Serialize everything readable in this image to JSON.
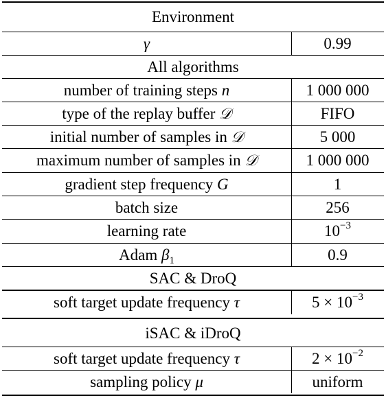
{
  "table": {
    "sections": [
      {
        "title": "Environment",
        "rows": [
          {
            "param": "",
            "symbol": "γ",
            "value": "0.99"
          }
        ]
      },
      {
        "title": "All algorithms",
        "rows": [
          {
            "param": "number of training steps",
            "symbol": "n",
            "value": "1 000 000"
          },
          {
            "param": "type of the replay buffer",
            "symbol": "𝒟",
            "value": "FIFO"
          },
          {
            "param": "initial number of samples in",
            "symbol": "𝒟",
            "value": "5 000"
          },
          {
            "param": "maximum number of samples in",
            "symbol": "𝒟",
            "value": "1 000 000"
          },
          {
            "param": "gradient step frequency",
            "symbol": "G",
            "value": "1"
          },
          {
            "param": "batch size",
            "symbol": "",
            "value": "256"
          },
          {
            "param": "learning rate",
            "symbol": "",
            "value_base": "10",
            "value_exp": "−3"
          },
          {
            "param": "Adam",
            "symbol": "β",
            "symbol_sub": "1",
            "value": "0.9"
          }
        ]
      },
      {
        "title": "SAC & DroQ",
        "rows": [
          {
            "param": "soft target update frequency",
            "symbol": "τ",
            "value_base": "5 × 10",
            "value_exp": "−3"
          }
        ]
      },
      {
        "title": "iSAC & iDroQ",
        "rows": [
          {
            "param": "soft target update frequency",
            "symbol": "τ",
            "value_base": "2 × 10",
            "value_exp": "−2"
          },
          {
            "param": "sampling policy",
            "symbol": "μ",
            "value": "uniform"
          }
        ]
      }
    ]
  }
}
